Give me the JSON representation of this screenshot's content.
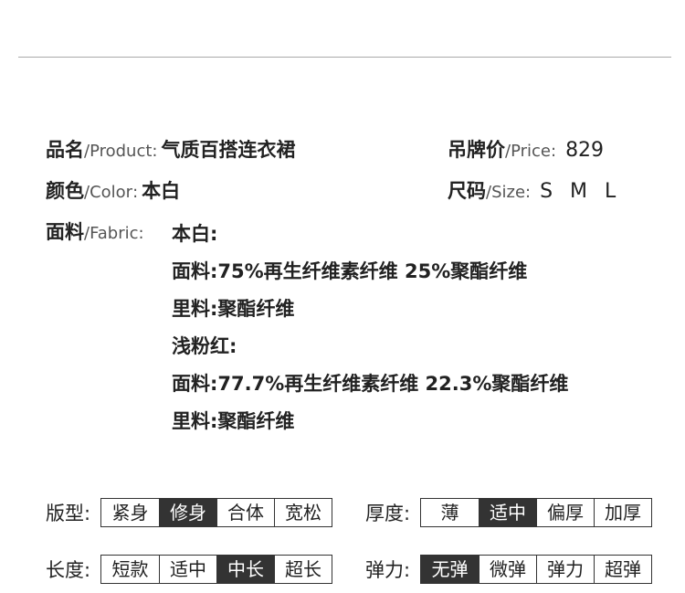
{
  "product": {
    "label_cn": "品名",
    "label_en": "/Product",
    "sep": ":",
    "value": "气质百搭连衣裙"
  },
  "price": {
    "label_cn": "吊牌价",
    "label_en": "/Price",
    "sep": ":",
    "value": "829"
  },
  "color": {
    "label_cn": "颜色",
    "label_en": "/Color",
    "sep": ":",
    "value": "本白"
  },
  "size": {
    "label_cn": "尺码",
    "label_en": "/Size",
    "sep": ":",
    "value": "S M L"
  },
  "fabric": {
    "label_cn": "面料",
    "label_en": "/Fabric",
    "sep": ":",
    "lines": [
      "本白:",
      "面料:75%再生纤维素纤维 25%聚酯纤维",
      "里料:聚酯纤维",
      "浅粉红:",
      "面料:77.7%再生纤维素纤维 22.3%聚酯纤维",
      "里料:聚酯纤维"
    ]
  },
  "attributes": {
    "fit": {
      "label": "版型:",
      "options": [
        "紧身",
        "修身",
        "合体",
        "宽松"
      ],
      "selected": "修身"
    },
    "thickness": {
      "label": "厚度:",
      "options": [
        "薄",
        "适中",
        "偏厚",
        "加厚"
      ],
      "selected": "适中"
    },
    "length": {
      "label": "长度:",
      "options": [
        "短款",
        "适中",
        "中长",
        "超长"
      ],
      "selected": "中长"
    },
    "elasticity": {
      "label": "弹力:",
      "options": [
        "无弹",
        "微弹",
        "弹力",
        "超弹"
      ],
      "selected": "无弹"
    }
  }
}
